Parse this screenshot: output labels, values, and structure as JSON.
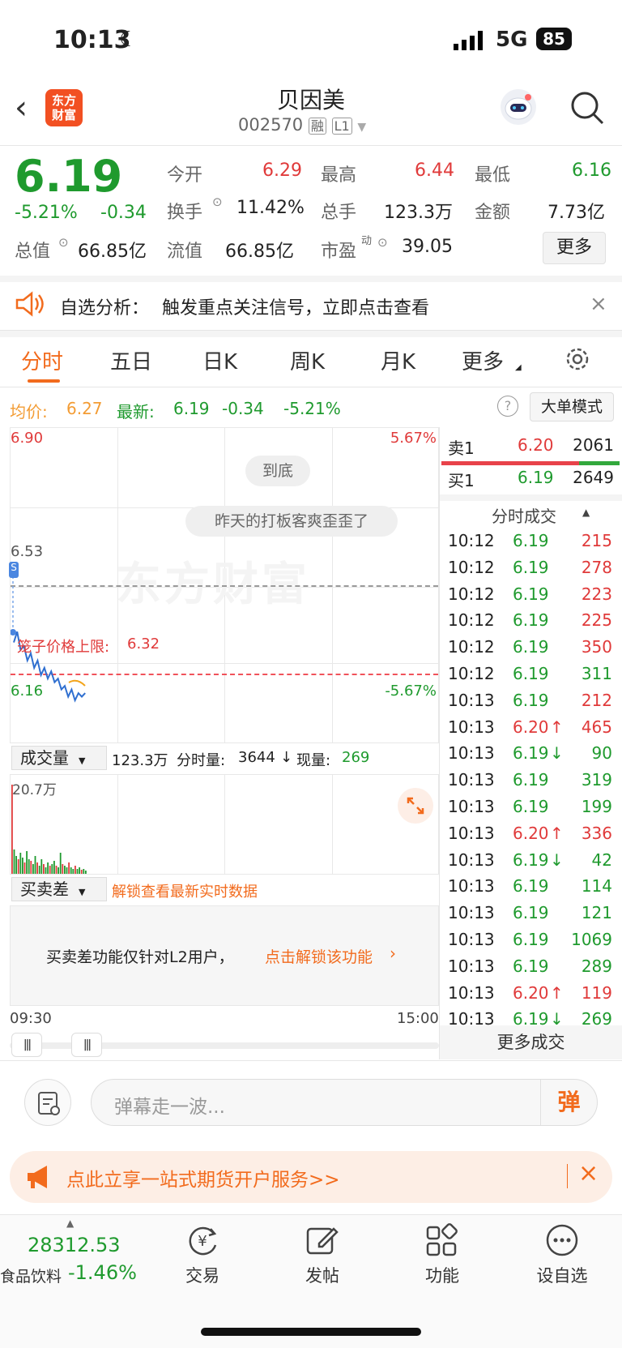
{
  "status": {
    "time": "10:13",
    "network": "5G",
    "battery": "85"
  },
  "header": {
    "title": "贝因美",
    "code": "002570",
    "tag1": "融",
    "tag2": "L1",
    "logo": "东方财富",
    "logo_l1": "东方",
    "logo_l2": "财富"
  },
  "quote": {
    "price": "6.19",
    "pct": "-5.21%",
    "chg": "-0.34",
    "open_label": "今开",
    "open": "6.29",
    "high_label": "最高",
    "high": "6.44",
    "low_label": "最低",
    "low": "6.16",
    "turnover_label": "换手",
    "turnover": "11.42%",
    "vol_label": "总手",
    "vol": "123.3万",
    "amount_label": "金额",
    "amount": "7.73亿",
    "mcap_label": "总值",
    "mcap": "66.85亿",
    "float_label": "流值",
    "float": "66.85亿",
    "pe_label": "市盈",
    "pe_sup": "动",
    "pe": "39.05",
    "more": "更多"
  },
  "banner1": {
    "label": "自选分析：",
    "text": "触发重点关注信号，立即点击查看"
  },
  "tabs": [
    {
      "label": "分时"
    },
    {
      "label": "五日"
    },
    {
      "label": "日K"
    },
    {
      "label": "周K"
    },
    {
      "label": "月K"
    },
    {
      "label": "更多"
    }
  ],
  "infobar": {
    "avg_label": "均价:",
    "avg": "6.27",
    "last_label": "最新:",
    "last": "6.19",
    "chg": "-0.34",
    "pct": "-5.21%",
    "mode": "大单模式"
  },
  "chart": {
    "ymax": "6.90",
    "ymax_pct": "5.67%",
    "ymid": "6.53",
    "ymin": "6.16",
    "ymin_pct": "-5.67%",
    "limit_label": "笼子价格上限:",
    "limit": "6.32",
    "toast1": "到底",
    "toast2": "昨天的打板客爽歪歪了",
    "watermark": "东方财富",
    "t_start": "09:30",
    "t_end": "15:00",
    "price_line": [
      [
        0,
        6.32
      ],
      [
        1,
        6.35
      ],
      [
        2,
        6.3
      ],
      [
        3,
        6.31
      ],
      [
        4,
        6.27
      ],
      [
        5,
        6.29
      ],
      [
        6,
        6.25
      ],
      [
        7,
        6.27
      ],
      [
        8,
        6.23
      ],
      [
        9,
        6.25
      ],
      [
        10,
        6.22
      ],
      [
        11,
        6.24
      ],
      [
        12,
        6.21
      ],
      [
        13,
        6.22
      ],
      [
        14,
        6.19
      ],
      [
        15,
        6.2
      ],
      [
        16,
        6.17
      ],
      [
        17,
        6.19
      ],
      [
        18,
        6.16
      ],
      [
        19,
        6.18
      ],
      [
        20,
        6.17
      ],
      [
        21,
        6.18
      ]
    ]
  },
  "volume": {
    "selector": "成交量",
    "total": "123.3万",
    "seg_label": "分时量:",
    "seg": "3644",
    "now_label": "现量:",
    "now": "269",
    "ymax": "20.7万"
  },
  "spread": {
    "selector": "买卖差",
    "unlock": "解锁查看最新实时数据",
    "msg": "买卖差功能仅针对L2用户，",
    "link": "点击解锁该功能"
  },
  "orderbook": {
    "sell_label": "卖1",
    "sell_price": "6.20",
    "sell_vol": "2061",
    "buy_label": "买1",
    "buy_price": "6.19",
    "buy_vol": "2649",
    "trades_title": "分时成交",
    "more": "更多成交"
  },
  "trades": [
    {
      "t": "10:12",
      "p": "6.19",
      "v": "215",
      "vc": "red",
      "pc": "green",
      "a": ""
    },
    {
      "t": "10:12",
      "p": "6.19",
      "v": "278",
      "vc": "red",
      "pc": "green",
      "a": ""
    },
    {
      "t": "10:12",
      "p": "6.19",
      "v": "223",
      "vc": "red",
      "pc": "green",
      "a": ""
    },
    {
      "t": "10:12",
      "p": "6.19",
      "v": "225",
      "vc": "red",
      "pc": "green",
      "a": ""
    },
    {
      "t": "10:12",
      "p": "6.19",
      "v": "350",
      "vc": "red",
      "pc": "green",
      "a": ""
    },
    {
      "t": "10:12",
      "p": "6.19",
      "v": "311",
      "vc": "green",
      "pc": "green",
      "a": ""
    },
    {
      "t": "10:13",
      "p": "6.19",
      "v": "212",
      "vc": "red",
      "pc": "green",
      "a": ""
    },
    {
      "t": "10:13",
      "p": "6.20",
      "v": "465",
      "vc": "red",
      "pc": "red",
      "a": "↑"
    },
    {
      "t": "10:13",
      "p": "6.19",
      "v": "90",
      "vc": "green",
      "pc": "green",
      "a": "↓"
    },
    {
      "t": "10:13",
      "p": "6.19",
      "v": "319",
      "vc": "green",
      "pc": "green",
      "a": ""
    },
    {
      "t": "10:13",
      "p": "6.19",
      "v": "199",
      "vc": "green",
      "pc": "green",
      "a": ""
    },
    {
      "t": "10:13",
      "p": "6.20",
      "v": "336",
      "vc": "red",
      "pc": "red",
      "a": "↑"
    },
    {
      "t": "10:13",
      "p": "6.19",
      "v": "42",
      "vc": "green",
      "pc": "green",
      "a": "↓"
    },
    {
      "t": "10:13",
      "p": "6.19",
      "v": "114",
      "vc": "green",
      "pc": "green",
      "a": ""
    },
    {
      "t": "10:13",
      "p": "6.19",
      "v": "121",
      "vc": "green",
      "pc": "green",
      "a": ""
    },
    {
      "t": "10:13",
      "p": "6.19",
      "v": "1069",
      "vc": "green",
      "pc": "green",
      "a": ""
    },
    {
      "t": "10:13",
      "p": "6.19",
      "v": "289",
      "vc": "green",
      "pc": "green",
      "a": ""
    },
    {
      "t": "10:13",
      "p": "6.20",
      "v": "119",
      "vc": "red",
      "pc": "red",
      "a": "↑"
    },
    {
      "t": "10:13",
      "p": "6.19",
      "v": "269",
      "vc": "green",
      "pc": "green",
      "a": "↓"
    }
  ],
  "comment": {
    "placeholder": "弹幕走一波...",
    "send": "弹"
  },
  "promo": {
    "text": "点此立享一站式期货开户服务>>"
  },
  "bottom": {
    "index": "28312.53",
    "sector": "食品饮料",
    "sector_pct": "-1.46%",
    "nav": [
      "交易",
      "发帖",
      "功能",
      "设自选"
    ]
  }
}
